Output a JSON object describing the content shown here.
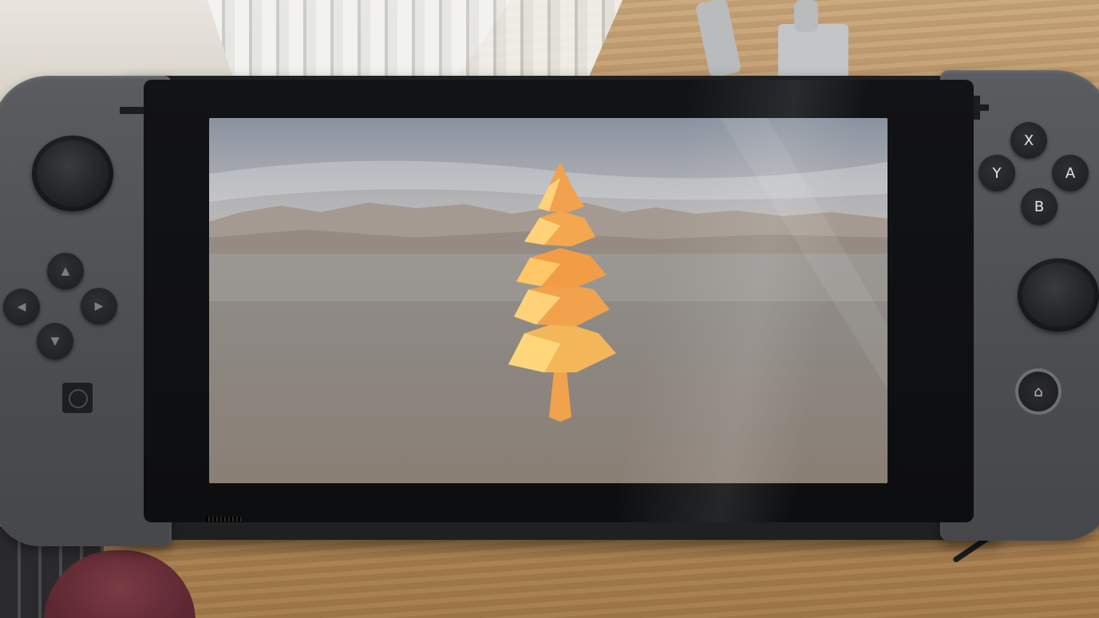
{
  "scene": {
    "subject": "handheld game console",
    "game_view": "low-poly tree over water with mountains"
  },
  "right_joycon": {
    "buttons": {
      "x": "X",
      "y": "Y",
      "a": "A",
      "b": "B"
    }
  },
  "colors": {
    "console_body": "#1f2022",
    "joycon_gray": "#4b4d51",
    "tree_orange": "#f0a24c",
    "tree_yellow": "#ffd77a",
    "table_wood": "#b58c5c"
  }
}
